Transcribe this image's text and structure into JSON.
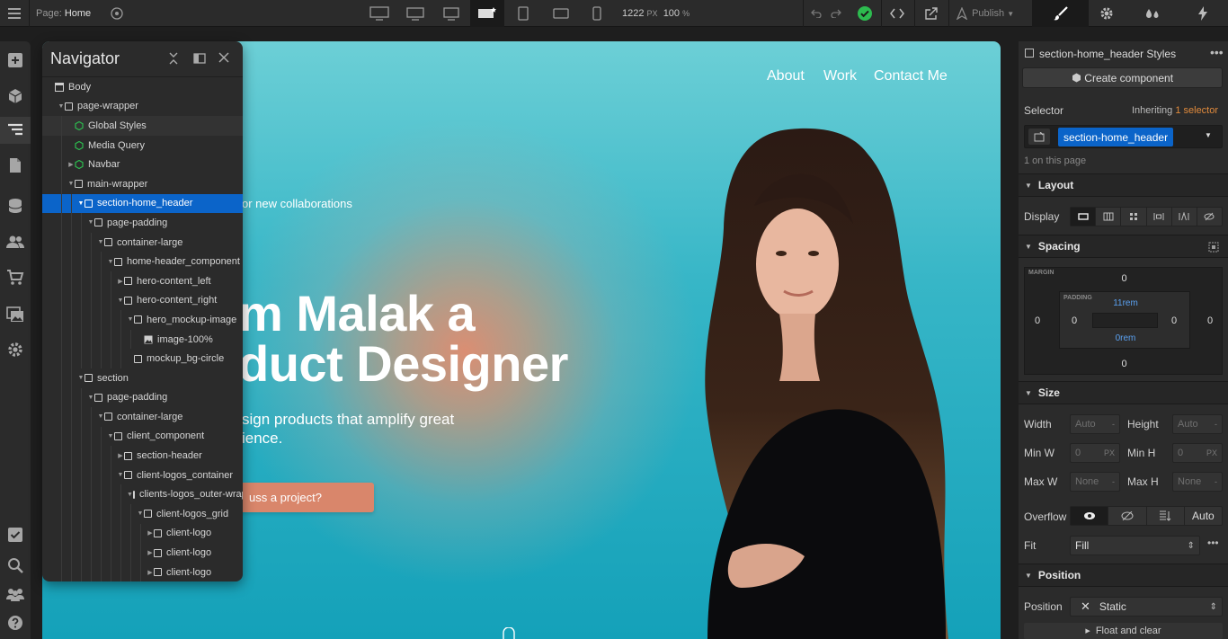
{
  "topbar": {
    "page_label": "Page:",
    "page_name": "Home",
    "width_value": "1222",
    "width_unit": "PX",
    "zoom_value": "100",
    "zoom_unit": "%",
    "publish_label": "Publish"
  },
  "canvas": {
    "nav_links": [
      "About",
      "Work",
      "Contact Me"
    ],
    "hero_small": "or new collaborations",
    "hero_title_line1": "m Malak a",
    "hero_title_line2": "duct Designer",
    "hero_desc_line1": "sign products that amplify great",
    "hero_desc_line2": "ience.",
    "cta_label": "uss a project?"
  },
  "navigator": {
    "title": "Navigator",
    "tree": [
      {
        "label": "Body",
        "depth": 0,
        "icon": "body-icon",
        "caret": false
      },
      {
        "label": "page-wrapper",
        "depth": 1,
        "icon": "box",
        "caret": true
      },
      {
        "label": "Global Styles",
        "depth": 2,
        "icon": "component-icon",
        "caret": false,
        "highlight": true
      },
      {
        "label": "Media Query",
        "depth": 2,
        "icon": "component-icon",
        "caret": false
      },
      {
        "label": "Navbar",
        "depth": 2,
        "icon": "component-icon",
        "caret": "closed"
      },
      {
        "label": "main-wrapper",
        "depth": 2,
        "icon": "box",
        "caret": true
      },
      {
        "label": "section-home_header",
        "depth": 3,
        "icon": "box",
        "caret": true,
        "selected": true
      },
      {
        "label": "page-padding",
        "depth": 4,
        "icon": "box",
        "caret": true
      },
      {
        "label": "container-large",
        "depth": 5,
        "icon": "box",
        "caret": true
      },
      {
        "label": "home-header_component",
        "depth": 6,
        "icon": "box",
        "caret": true
      },
      {
        "label": "hero-content_left",
        "depth": 7,
        "icon": "box",
        "caret": "closed"
      },
      {
        "label": "hero-content_right",
        "depth": 7,
        "icon": "box",
        "caret": true
      },
      {
        "label": "hero_mockup-image",
        "depth": 8,
        "icon": "box",
        "caret": true
      },
      {
        "label": "image-100%",
        "depth": 9,
        "icon": "image-icon",
        "caret": false
      },
      {
        "label": "mockup_bg-circle",
        "depth": 8,
        "icon": "box",
        "caret": false
      },
      {
        "label": "section",
        "depth": 3,
        "icon": "box",
        "caret": true
      },
      {
        "label": "page-padding",
        "depth": 4,
        "icon": "box",
        "caret": true
      },
      {
        "label": "container-large",
        "depth": 5,
        "icon": "box",
        "caret": true
      },
      {
        "label": "client_component",
        "depth": 6,
        "icon": "box",
        "caret": true
      },
      {
        "label": "section-header",
        "depth": 7,
        "icon": "box",
        "caret": "closed"
      },
      {
        "label": "client-logos_container",
        "depth": 7,
        "icon": "box",
        "caret": true
      },
      {
        "label": "clients-logos_outer-wrap",
        "depth": 8,
        "icon": "box",
        "caret": true
      },
      {
        "label": "client-logos_grid",
        "depth": 9,
        "icon": "box",
        "caret": true
      },
      {
        "label": "client-logo",
        "depth": 10,
        "icon": "box",
        "caret": "closed"
      },
      {
        "label": "client-logo",
        "depth": 10,
        "icon": "box",
        "caret": "closed"
      },
      {
        "label": "client-logo",
        "depth": 10,
        "icon": "box",
        "caret": "closed"
      }
    ]
  },
  "style_panel": {
    "header_title": "section-home_header Styles",
    "create_component": "Create component",
    "selector_label": "Selector",
    "inheriting_label": "Inheriting",
    "inheriting_count": "1 selector",
    "selector_chip": "section-home_header",
    "on_page": "1 on this page",
    "layout": {
      "title": "Layout",
      "display_label": "Display"
    },
    "spacing": {
      "title": "Spacing",
      "margin_label": "MARGIN",
      "padding_label": "PADDING",
      "margin_top": "0",
      "margin_right": "0",
      "margin_bottom": "0",
      "margin_left": "0",
      "padding_top": "11rem",
      "padding_right": "0",
      "padding_bottom": "0rem",
      "padding_left": "0"
    },
    "size": {
      "title": "Size",
      "width_label": "Width",
      "width_value": "Auto",
      "height_label": "Height",
      "height_value": "Auto",
      "minw_label": "Min W",
      "minw_value": "0",
      "minw_unit": "PX",
      "minh_label": "Min H",
      "minh_value": "0",
      "minh_unit": "PX",
      "maxw_label": "Max W",
      "maxw_value": "None",
      "maxh_label": "Max H",
      "maxh_value": "None",
      "overflow_label": "Overflow",
      "overflow_auto": "Auto",
      "fit_label": "Fit",
      "fit_value": "Fill"
    },
    "position": {
      "title": "Position",
      "position_label": "Position",
      "position_value": "Static",
      "float_label": "Float and clear"
    }
  },
  "colors": {
    "accent_blue": "#0b64c9",
    "accent_orange": "#e08a3c",
    "publish_green": "#2dbb4f",
    "cta": "#d9866b"
  }
}
